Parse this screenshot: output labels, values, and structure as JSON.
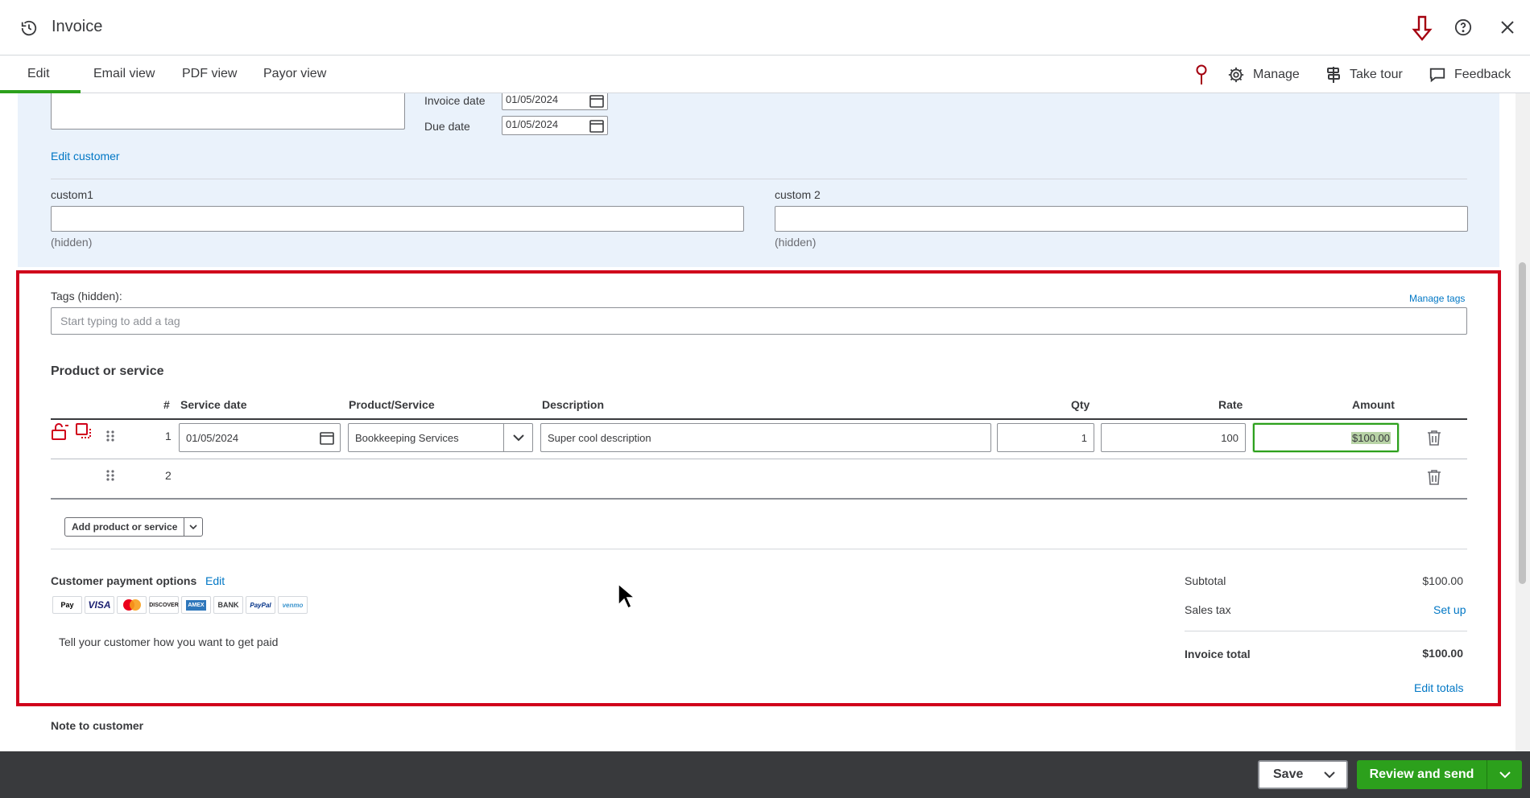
{
  "header": {
    "title": "Invoice",
    "icons": [
      "history-icon",
      "down-arrow-icon",
      "help-icon",
      "close-icon"
    ]
  },
  "tabs": [
    {
      "label": "Edit",
      "active": true
    },
    {
      "label": "Email view"
    },
    {
      "label": "PDF view"
    },
    {
      "label": "Payor view"
    }
  ],
  "toolbar": {
    "manage_label": "Manage",
    "tour_label": "Take tour",
    "feedback_label": "Feedback"
  },
  "customer": {
    "invoice_date_label": "Invoice date",
    "invoice_date_value": "01/05/2024",
    "due_date_label": "Due date",
    "due_date_value": "01/05/2024",
    "edit_customer_label": "Edit customer"
  },
  "custom_fields": [
    {
      "label": "custom1",
      "value": "",
      "note": "(hidden)"
    },
    {
      "label": "custom 2",
      "value": "",
      "note": "(hidden)"
    }
  ],
  "tags": {
    "label": "Tags (hidden):",
    "manage_label": "Manage tags",
    "placeholder": "Start typing to add a tag"
  },
  "products": {
    "title": "Product or service",
    "columns": {
      "num": "#",
      "service_date": "Service date",
      "product": "Product/Service",
      "description": "Description",
      "qty": "Qty",
      "rate": "Rate",
      "amount": "Amount"
    },
    "rows": [
      {
        "num": "1",
        "service_date": "01/05/2024",
        "product": "Bookkeeping Services",
        "description": "Super cool description",
        "qty": "1",
        "rate": "100",
        "amount": "$100.00"
      },
      {
        "num": "2"
      }
    ],
    "add_label": "Add product or service"
  },
  "payment": {
    "title": "Customer payment options",
    "edit_label": "Edit",
    "methods": [
      "Pay",
      "VISA",
      "mastercard",
      "DISCOVER",
      "AMEX",
      "BANK",
      "PayPal",
      "venmo"
    ],
    "note": "Tell your customer how you want to get paid"
  },
  "totals": {
    "subtotal_label": "Subtotal",
    "subtotal_value": "$100.00",
    "tax_label": "Sales tax",
    "tax_link": "Set up",
    "total_label": "Invoice total",
    "total_value": "$100.00",
    "edit_totals_label": "Edit totals"
  },
  "note_label": "Note to customer",
  "footer": {
    "save_label": "Save",
    "review_label": "Review and send"
  },
  "colors": {
    "accent_green": "#2ca01c",
    "link_blue": "#0077c5",
    "highlight_red": "#d0021b"
  }
}
